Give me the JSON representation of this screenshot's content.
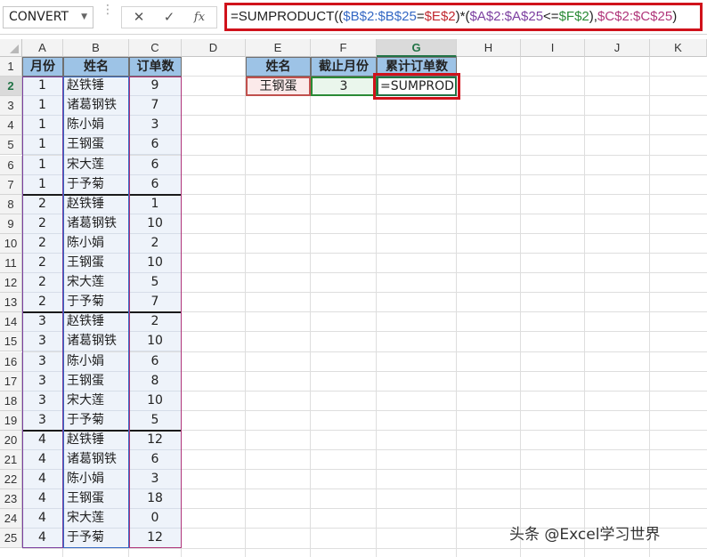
{
  "namebox": {
    "value": "CONVERT"
  },
  "fx": {
    "cancel": "✕",
    "enter": "✓",
    "insert": "fx"
  },
  "formula": {
    "parts": [
      {
        "text": "=SUMPRODUCT((",
        "color": "black"
      },
      {
        "text": "$B$2:$B$25",
        "color": "blue"
      },
      {
        "text": "=",
        "color": "black"
      },
      {
        "text": "$E$2",
        "color": "red"
      },
      {
        "text": ")*(",
        "color": "black"
      },
      {
        "text": "$A$2:$A$25",
        "color": "purple"
      },
      {
        "text": "<=",
        "color": "black"
      },
      {
        "text": "$F$2",
        "color": "green"
      },
      {
        "text": "),",
        "color": "black"
      },
      {
        "text": "$C$2:$C$25",
        "color": "magenta"
      },
      {
        "text": ")",
        "color": "black"
      }
    ]
  },
  "columns": [
    "A",
    "B",
    "C",
    "D",
    "E",
    "F",
    "G",
    "H",
    "I",
    "J",
    "K"
  ],
  "selected_column": "G",
  "selected_row": "2",
  "table": {
    "headers": [
      "月份",
      "姓名",
      "订单数"
    ],
    "rows": [
      [
        "1",
        "赵铁锤",
        "9"
      ],
      [
        "1",
        "诸葛钢铁",
        "7"
      ],
      [
        "1",
        "陈小娟",
        "3"
      ],
      [
        "1",
        "王钢蛋",
        "6"
      ],
      [
        "1",
        "宋大莲",
        "6"
      ],
      [
        "1",
        "于予菊",
        "6"
      ],
      [
        "2",
        "赵铁锤",
        "1"
      ],
      [
        "2",
        "诸葛钢铁",
        "10"
      ],
      [
        "2",
        "陈小娟",
        "2"
      ],
      [
        "2",
        "王钢蛋",
        "10"
      ],
      [
        "2",
        "宋大莲",
        "5"
      ],
      [
        "2",
        "于予菊",
        "7"
      ],
      [
        "3",
        "赵铁锤",
        "2"
      ],
      [
        "3",
        "诸葛钢铁",
        "10"
      ],
      [
        "3",
        "陈小娟",
        "6"
      ],
      [
        "3",
        "王钢蛋",
        "8"
      ],
      [
        "3",
        "宋大莲",
        "10"
      ],
      [
        "3",
        "于予菊",
        "5"
      ],
      [
        "4",
        "赵铁锤",
        "12"
      ],
      [
        "4",
        "诸葛钢铁",
        "6"
      ],
      [
        "4",
        "陈小娟",
        "3"
      ],
      [
        "4",
        "王钢蛋",
        "18"
      ],
      [
        "4",
        "宋大莲",
        "0"
      ],
      [
        "4",
        "于予菊",
        "12"
      ]
    ]
  },
  "criteria": {
    "headers": [
      "姓名",
      "截止月份",
      "累计订单数"
    ],
    "name": "王钢蛋",
    "month": "3",
    "editing": "=SUMPROD"
  },
  "watermark": "头条 @Excel学习世界",
  "colors": {
    "header_fill": "#9dc3e6",
    "data_fill": "#eef3fa",
    "highlight": "#d0121b",
    "excel_green": "#217346",
    "name_border": "#c0504d",
    "month_border": "#2a8a35"
  }
}
